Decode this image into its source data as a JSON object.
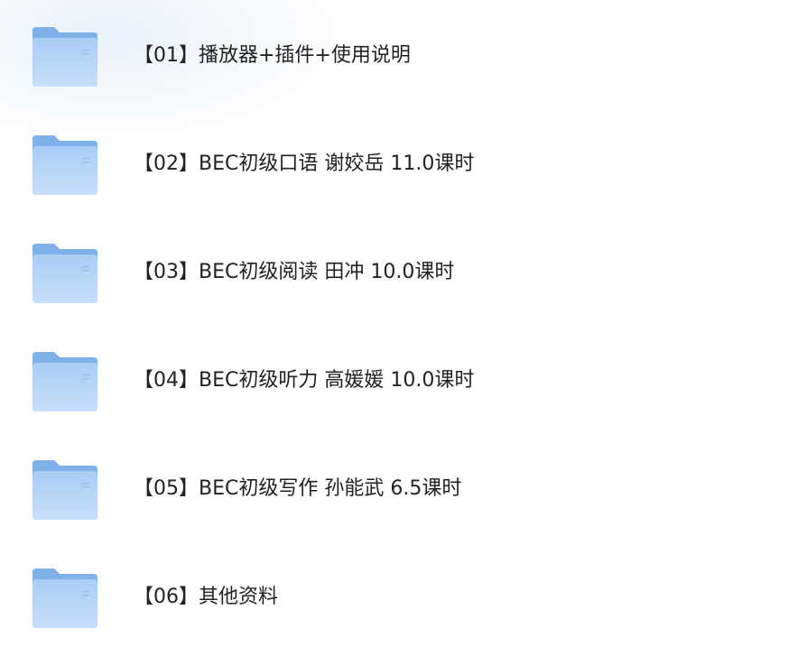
{
  "colors": {
    "folder_back": "#7fb0ea",
    "folder_front_top": "#a9cdf6",
    "folder_front_bottom": "#c7dffa",
    "folder_line": "#9fc1ea",
    "text": "#222222"
  },
  "folders": [
    {
      "icon": "folder-icon",
      "label": "【01】播放器+插件+使用说明"
    },
    {
      "icon": "folder-icon",
      "label": "【02】BEC初级口语 谢姣岳 11.0课时"
    },
    {
      "icon": "folder-icon",
      "label": "【03】BEC初级阅读 田冲 10.0课时"
    },
    {
      "icon": "folder-icon",
      "label": "【04】BEC初级听力 高媛媛 10.0课时"
    },
    {
      "icon": "folder-icon",
      "label": "【05】BEC初级写作 孙能武 6.5课时"
    },
    {
      "icon": "folder-icon",
      "label": "【06】其他资料"
    }
  ]
}
